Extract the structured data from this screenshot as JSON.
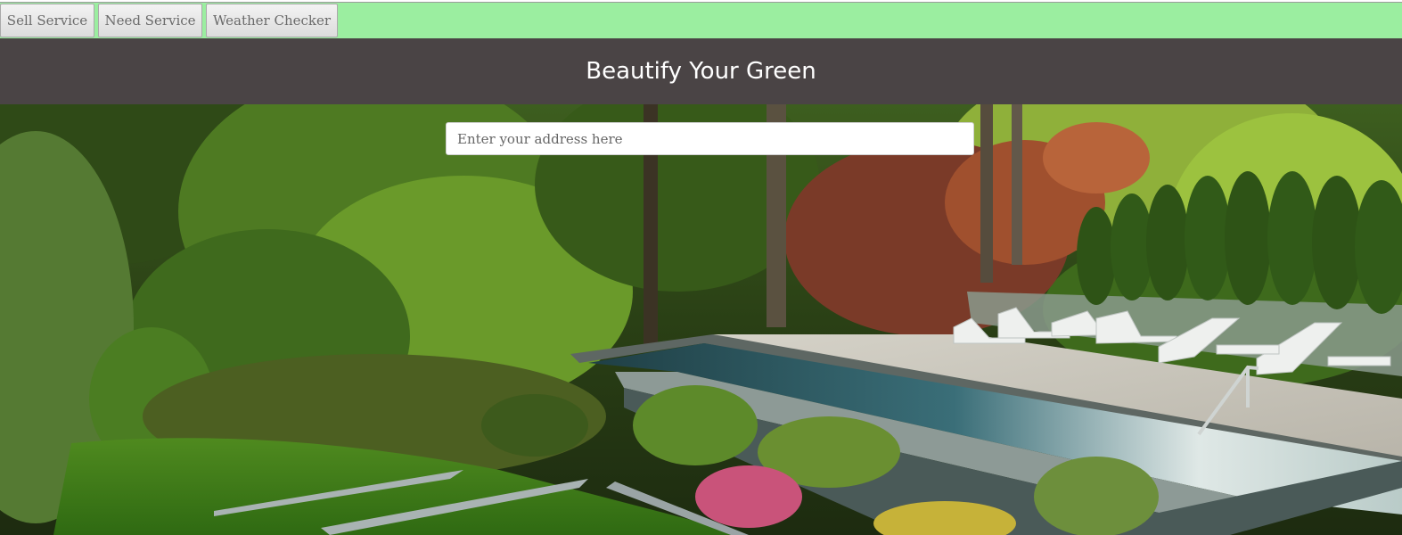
{
  "nav": {
    "buttons": [
      {
        "label": "Sell Service"
      },
      {
        "label": "Need Service"
      },
      {
        "label": "Weather Checker"
      }
    ]
  },
  "header": {
    "title": "Beautify Your Green"
  },
  "search": {
    "placeholder": "Enter your address here",
    "value": ""
  },
  "colors": {
    "nav_background": "#9beea0",
    "header_background": "#4a4445",
    "header_text": "#ffffff"
  }
}
